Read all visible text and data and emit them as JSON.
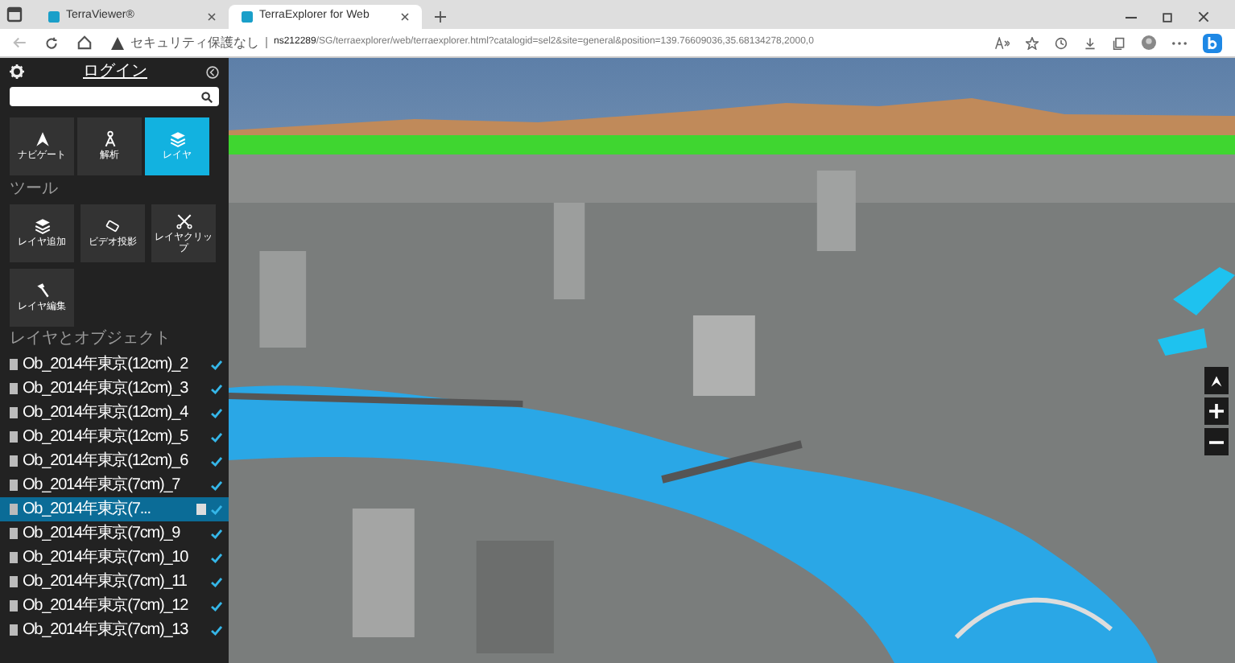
{
  "browser": {
    "tabs": [
      {
        "title": "TerraViewer®",
        "selected": false
      },
      {
        "title": "TerraExplorer for Web",
        "selected": true
      }
    ],
    "security": "セキュリティ保護なし",
    "url_host": "ns212289",
    "url_path": "/SG/terraexplorer/web/terraexplorer.html?catalogid=sel2&site=general&position=139.76609036,35.68134278,2000,0"
  },
  "sidebar": {
    "login": "ログイン",
    "nav": [
      {
        "label": "ナビゲート",
        "selected": false
      },
      {
        "label": "解析",
        "selected": false
      },
      {
        "label": "レイヤ",
        "selected": true
      }
    ],
    "tools_heading": "ツール",
    "tools": [
      {
        "label": "レイヤ追加"
      },
      {
        "label": "ビデオ投影"
      },
      {
        "label": "レイヤクリップ"
      },
      {
        "label": "レイヤ編集"
      }
    ],
    "layers_heading": "レイヤとオブジェクト",
    "layers": [
      {
        "name": "Ob_2014年東京(12cm)_2",
        "checked": true,
        "selected": false
      },
      {
        "name": "Ob_2014年東京(12cm)_3",
        "checked": true,
        "selected": false
      },
      {
        "name": "Ob_2014年東京(12cm)_4",
        "checked": true,
        "selected": false
      },
      {
        "name": "Ob_2014年東京(12cm)_5",
        "checked": true,
        "selected": false
      },
      {
        "name": "Ob_2014年東京(12cm)_6",
        "checked": true,
        "selected": false
      },
      {
        "name": "Ob_2014年東京(7cm)_7",
        "checked": true,
        "selected": false
      },
      {
        "name": "Ob_2014年東京(7...",
        "checked": true,
        "selected": true
      },
      {
        "name": "Ob_2014年東京(7cm)_9",
        "checked": true,
        "selected": false
      },
      {
        "name": "Ob_2014年東京(7cm)_10",
        "checked": true,
        "selected": false
      },
      {
        "name": "Ob_2014年東京(7cm)_11",
        "checked": true,
        "selected": false
      },
      {
        "name": "Ob_2014年東京(7cm)_12",
        "checked": true,
        "selected": false
      },
      {
        "name": "Ob_2014年東京(7cm)_13",
        "checked": true,
        "selected": false
      }
    ]
  }
}
